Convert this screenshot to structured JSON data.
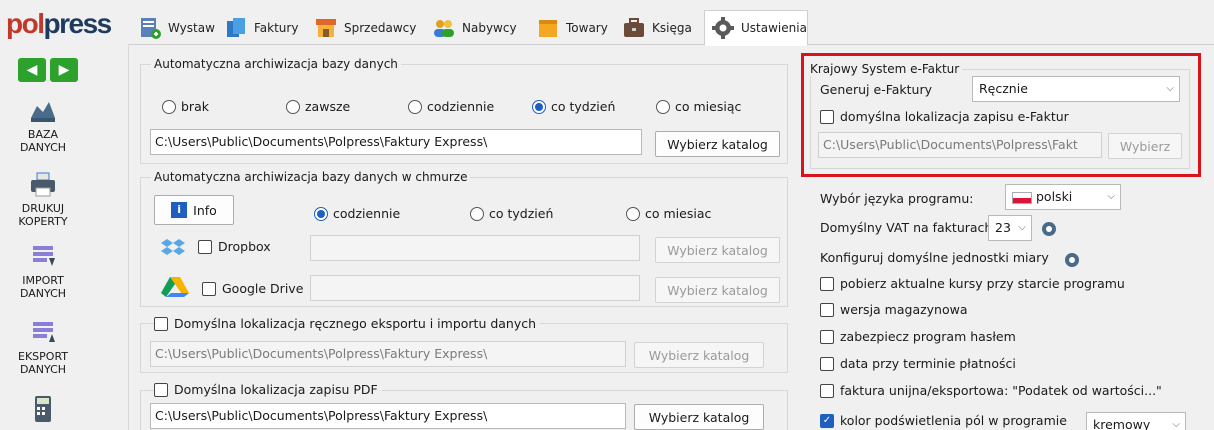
{
  "app": {
    "logo": "polpress",
    "logo_part1": "pol",
    "logo_part2": "press"
  },
  "tabs": [
    {
      "label": "Wystaw",
      "icon": "invoice-add-icon"
    },
    {
      "label": "Faktury",
      "icon": "documents-icon"
    },
    {
      "label": "Sprzedawcy",
      "icon": "shop-icon"
    },
    {
      "label": "Nabywcy",
      "icon": "people-icon"
    },
    {
      "label": "Towary",
      "icon": "box-icon"
    },
    {
      "label": "Księga",
      "icon": "briefcase-icon"
    },
    {
      "label": "Ustawienia",
      "icon": "gear-icon",
      "active": true
    }
  ],
  "sidebar": {
    "prev": "◀",
    "next": "▶",
    "items": [
      {
        "label": "BAZA DANYCH",
        "line1": "BAZA",
        "line2": "DANYCH",
        "icon": "database-icon"
      },
      {
        "label": "DRUKUJ KOPERTY",
        "line1": "DRUKUJ",
        "line2": "KOPERTY",
        "icon": "printer-icon"
      },
      {
        "label": "IMPORT DANYCH",
        "line1": "IMPORT",
        "line2": "DANYCH",
        "icon": "import-icon"
      },
      {
        "label": "EKSPORT DANYCH",
        "line1": "EKSPORT",
        "line2": "DANYCH",
        "icon": "export-icon"
      },
      {
        "label": "",
        "icon": "calculator-icon"
      }
    ]
  },
  "archive": {
    "title": "Automatyczna archiwizacja bazy danych",
    "options": [
      "brak",
      "zawsze",
      "codziennie",
      "co tydzień",
      "co miesiąc"
    ],
    "selected": "co tydzień",
    "path": "C:\\Users\\Public\\Documents\\Polpress\\Faktury Express\\",
    "choose": "Wybierz katalog"
  },
  "cloud": {
    "title": "Automatyczna archiwizacja bazy danych w chmurze",
    "info": "Info",
    "options": [
      "codziennie",
      "co tydzień",
      "co miesiac"
    ],
    "selected": "codziennie",
    "dropbox": "Dropbox",
    "gdrive": "Google Drive",
    "choose": "Wybierz katalog"
  },
  "manual": {
    "title": "Domyślna lokalizacja ręcznego eksportu i importu danych",
    "path": "C:\\Users\\Public\\Documents\\Polpress\\Faktury Express\\",
    "choose": "Wybierz katalog"
  },
  "pdf": {
    "title": "Domyślna lokalizacja zapisu PDF",
    "path": "C:\\Users\\Public\\Documents\\Polpress\\Faktury Express\\",
    "choose": "Wybierz katalog"
  },
  "ksef": {
    "title": "Krajowy System e-Faktur",
    "gen_label": "Generuj e-Faktury",
    "gen_value": "Ręcznie",
    "loc_label": "domyślna lokalizacja zapisu e-Faktur",
    "path": "C:\\Users\\Public\\Documents\\Polpress\\Fakt",
    "choose": "Wybierz",
    "highlight_color": "#d9131c"
  },
  "settings": {
    "lang_label": "Wybór języka programu:",
    "lang_value": "polski",
    "vat_label": "Domyślny VAT na fakturach",
    "vat_value": "23",
    "units_label": "Konfiguruj domyślne jednostki miary",
    "checks": [
      {
        "label": "pobierz aktualne kursy przy starcie programu",
        "checked": false
      },
      {
        "label": "wersja magazynowa",
        "checked": false
      },
      {
        "label": "zabezpiecz program hasłem",
        "checked": false
      },
      {
        "label": "data przy terminie płatności",
        "checked": false
      },
      {
        "label": "faktura unijna/eksportowa: \"Podatek od wartości...\"",
        "checked": false
      },
      {
        "label": "kolor podświetlenia pól w programie",
        "checked": true
      }
    ],
    "color_value": "kremowy"
  }
}
